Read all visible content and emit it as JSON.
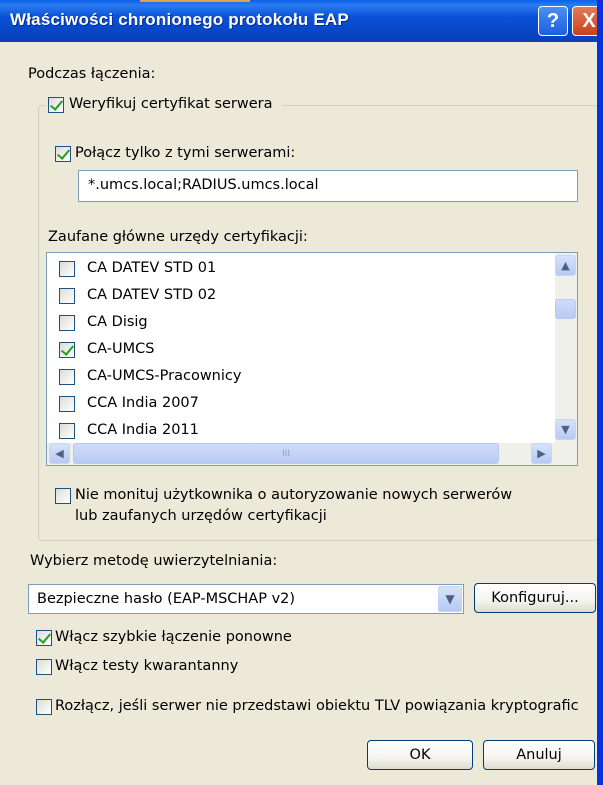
{
  "window": {
    "title": "Właściwości chronionego protokołu EAP",
    "help_glyph": "?",
    "close_glyph": "X"
  },
  "connect_label": "Podczas łączenia:",
  "verify_cert": {
    "label": "Weryfikuj certyfikat serwera",
    "checked": true
  },
  "connect_only": {
    "label": "Połącz tylko z tymi serwerami:",
    "checked": true
  },
  "servers_value": "*.umcs.local;RADIUS.umcs.local",
  "trusted_label": "Zaufane główne urzędy certyfikacji:",
  "ca_list": [
    {
      "label": "CA DATEV STD 01",
      "checked": false
    },
    {
      "label": "CA DATEV STD 02",
      "checked": false
    },
    {
      "label": "CA Disig",
      "checked": false
    },
    {
      "label": "CA-UMCS",
      "checked": true
    },
    {
      "label": "CA-UMCS-Pracownicy",
      "checked": false
    },
    {
      "label": "CCA India 2007",
      "checked": false
    },
    {
      "label": "CCA India 2011",
      "checked": false
    }
  ],
  "scroll": {
    "up": "▲",
    "down": "▼",
    "left": "◀",
    "right": "▶",
    "grip": "III"
  },
  "no_prompt": {
    "line1": "Nie monituj użytkownika o autoryzowanie nowych serwerów",
    "line2": "lub zaufanych urzędów certyfikacji",
    "checked": false
  },
  "auth_method_label": "Wybierz metodę uwierzytelniania:",
  "auth_method_value": "Bezpieczne hasło (EAP-MSCHAP v2)",
  "configure_button": "Konfiguruj...",
  "fast_reconnect": {
    "label": "Włącz szybkie łączenie ponowne",
    "checked": true
  },
  "quarantine": {
    "label": "Włącz testy kwarantanny",
    "checked": false
  },
  "disconnect": {
    "label": "Rozłącz, jeśli serwer nie przedstawi obiektu TLV powiązania kryptografic",
    "checked": false
  },
  "ok_button": "OK",
  "cancel_button": "Anuluj",
  "colors": {
    "titlebar": "#0a52d8",
    "dialog_bg": "#ece9d8",
    "check_green": "#21a121"
  }
}
